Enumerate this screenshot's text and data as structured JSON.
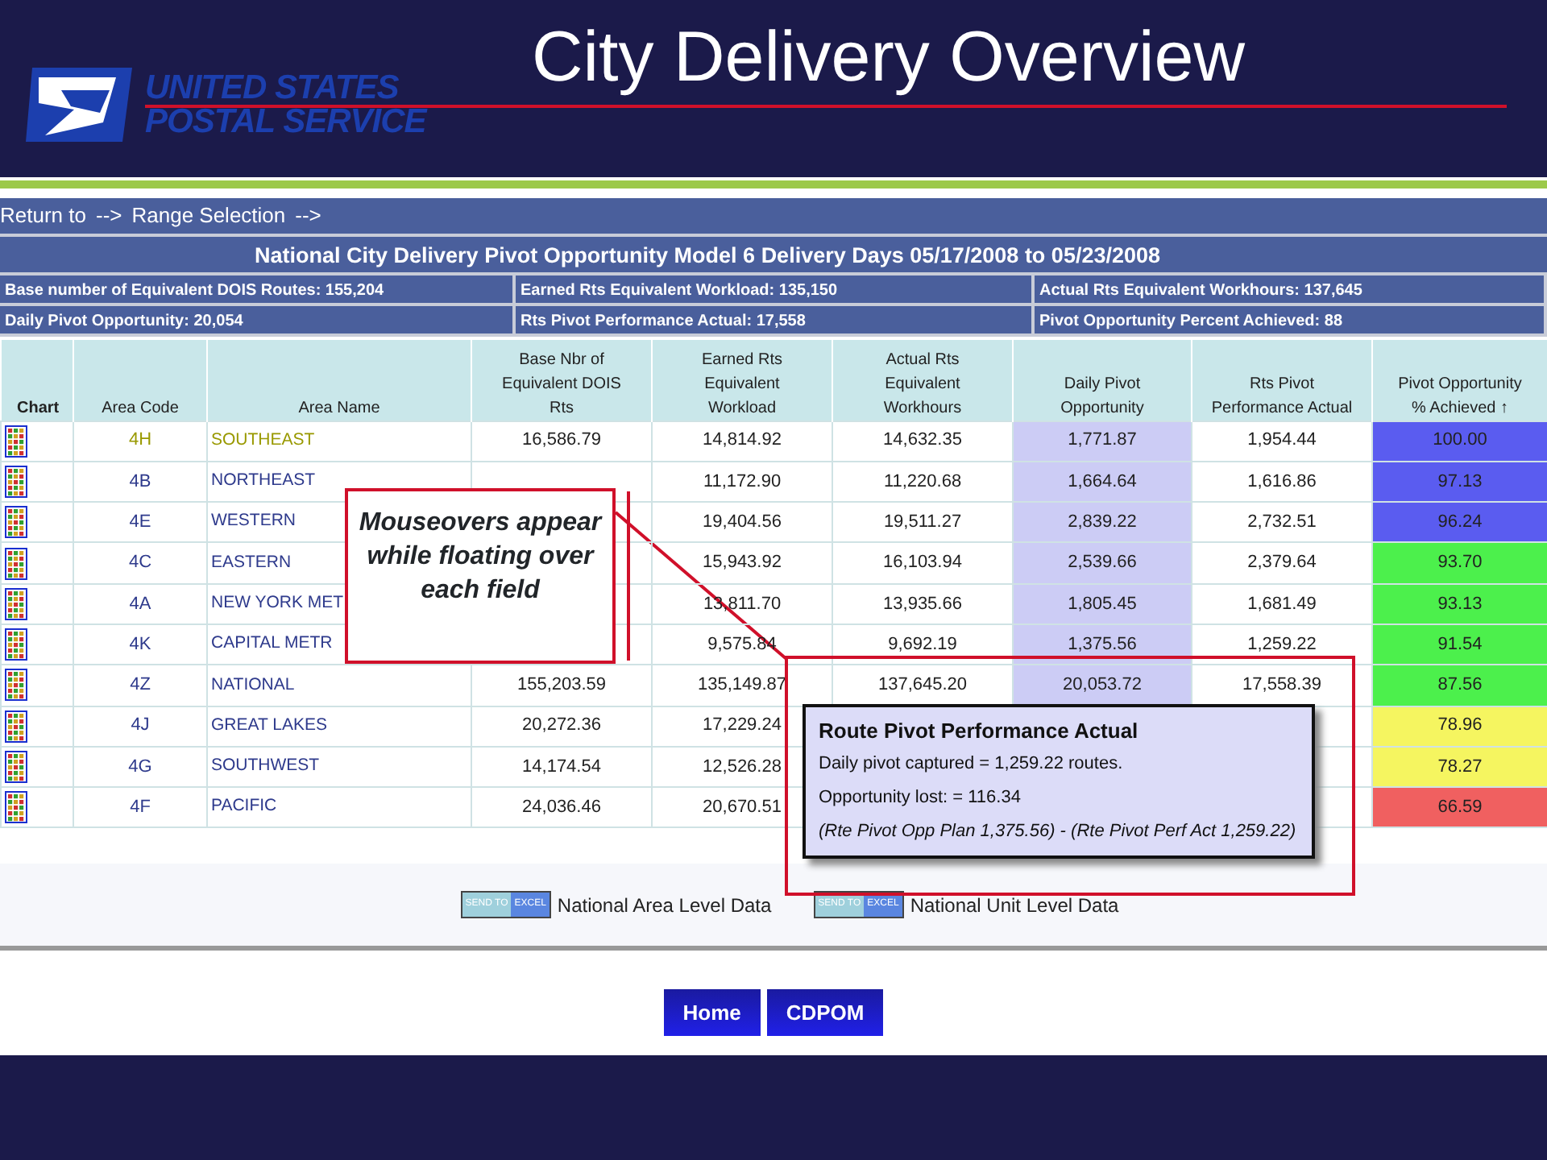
{
  "slide": {
    "title": "City Delivery Overview",
    "logo": {
      "line_1": "UNITED STATES",
      "line_2": "POSTAL SERVICE"
    }
  },
  "nav": {
    "label": "Return to",
    "arrow_1": "-->",
    "link": "Range Selection",
    "arrow_2": "-->"
  },
  "report_title": "National City Delivery Pivot Opportunity Model 6 Delivery Days  05/17/2008  to  05/23/2008",
  "stats": [
    "Base number of Equivalent DOIS Routes: 155,204",
    "Earned Rts Equivalent Workload: 135,150",
    "Actual Rts Equivalent Workhours: 137,645",
    "Daily Pivot Opportunity: 20,054",
    "Rts Pivot Performance Actual: 17,558",
    "Pivot Opportunity Percent Achieved: 88"
  ],
  "table": {
    "columns": [
      "Chart",
      "Area Code",
      "Area Name",
      "Base Nbr of Equivalent DOIS Rts",
      "Earned Rts Equivalent Workload",
      "Actual Rts Equivalent Workhours",
      "Daily Pivot Opportunity",
      "Rts Pivot Performance Actual",
      "Pivot Opportunity % Achieved ↑"
    ],
    "rows": [
      {
        "highlighted": true,
        "color": "#5a5cf0",
        "cells": [
          null,
          "4H",
          "SOUTHEAST",
          "16,586.79",
          "14,814.92",
          "14,632.35",
          "1,771.87",
          "1,954.44",
          "100.00"
        ]
      },
      {
        "highlighted": false,
        "color": "#5a5cf0",
        "cells": [
          null,
          "4B",
          "NORTHEAST",
          null,
          "11,172.90",
          "11,220.68",
          "1,664.64",
          "1,616.86",
          "97.13"
        ]
      },
      {
        "highlighted": false,
        "color": "#5a5cf0",
        "cells": [
          null,
          "4E",
          "WESTERN",
          null,
          "19,404.56",
          "19,511.27",
          "2,839.22",
          "2,732.51",
          "96.24"
        ]
      },
      {
        "highlighted": false,
        "color": "#4cf04c",
        "cells": [
          null,
          "4C",
          "EASTERN",
          null,
          "15,943.92",
          "16,103.94",
          "2,539.66",
          "2,379.64",
          "93.70"
        ]
      },
      {
        "highlighted": false,
        "color": "#4cf04c",
        "cells": [
          null,
          "4A",
          "NEW YORK MET",
          null,
          "13,811.70",
          "13,935.66",
          "1,805.45",
          "1,681.49",
          "93.13"
        ]
      },
      {
        "highlighted": false,
        "color": "#4cf04c",
        "cells": [
          null,
          "4K",
          "CAPITAL METR",
          null,
          "9,575.84",
          "9,692.19",
          "1,375.56",
          "1,259.22",
          "91.54"
        ]
      },
      {
        "highlighted": false,
        "color": "#4cf04c",
        "cells": [
          null,
          "4Z",
          "NATIONAL",
          "155,203.59",
          "135,149.87",
          "137,645.20",
          "20,053.72",
          "17,558.39",
          "87.56"
        ]
      },
      {
        "highlighted": false,
        "color": "#f5f560",
        "cells": [
          null,
          "4J",
          "GREAT LAKES",
          "20,272.36",
          "17,229.24",
          null,
          null,
          null,
          "78.96"
        ]
      },
      {
        "highlighted": false,
        "color": "#f5f560",
        "cells": [
          null,
          "4G",
          "SOUTHWEST",
          "14,174.54",
          "12,526.28",
          null,
          null,
          null,
          "78.27"
        ]
      },
      {
        "highlighted": false,
        "color": "#f06060",
        "cells": [
          null,
          "4F",
          "PACIFIC",
          "24,036.46",
          "20,670.51",
          null,
          null,
          null,
          "66.59"
        ]
      }
    ]
  },
  "callout": {
    "text": "Mouseovers appear while floating over each field"
  },
  "tooltip": {
    "title": "Route Pivot Performance Actual",
    "lines": [
      {
        "text": "Daily pivot captured = 1,259.22 routes.",
        "italic": false
      },
      {
        "text": "Opportunity lost: = 116.34",
        "italic": false
      },
      {
        "text": "(Rte Pivot Opp Plan 1,375.56) - (Rte Pivot Perf Act 1,259.22)",
        "italic": true
      }
    ]
  },
  "exports": [
    {
      "button": [
        "SEND TO",
        "EXCEL"
      ],
      "label": "National Area Level Data"
    },
    {
      "button": [
        "SEND TO",
        "EXCEL"
      ],
      "label": "National Unit Level Data"
    }
  ],
  "buttons": [
    "Home",
    "CDPOM"
  ]
}
